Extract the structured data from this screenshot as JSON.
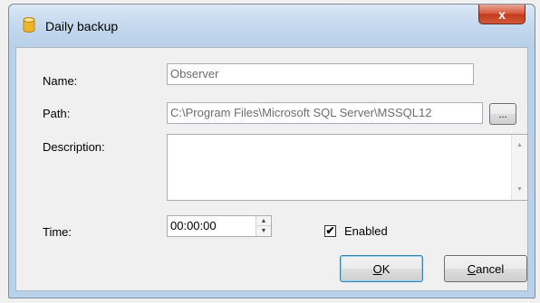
{
  "window": {
    "title": "Daily backup",
    "close_glyph": "x"
  },
  "form": {
    "name_label": "Name:",
    "name_value": "Observer",
    "path_label": "Path:",
    "path_value": "C:\\Program Files\\Microsoft SQL Server\\MSSQL12",
    "browse_label": "...",
    "description_label": "Description:",
    "description_value": "",
    "time_label": "Time:",
    "time_value": "00:00:00",
    "enabled_label": "Enabled",
    "enabled_checked": true,
    "checkbox_glyph": "✔"
  },
  "buttons": {
    "ok_accel": "O",
    "ok_rest": "K",
    "cancel_accel": "C",
    "cancel_rest": "ancel"
  },
  "icons": {
    "title_icon": "database-icon",
    "spin_up": "▲",
    "spin_down": "▼",
    "scroll_up": "▲",
    "scroll_down": "▼"
  }
}
